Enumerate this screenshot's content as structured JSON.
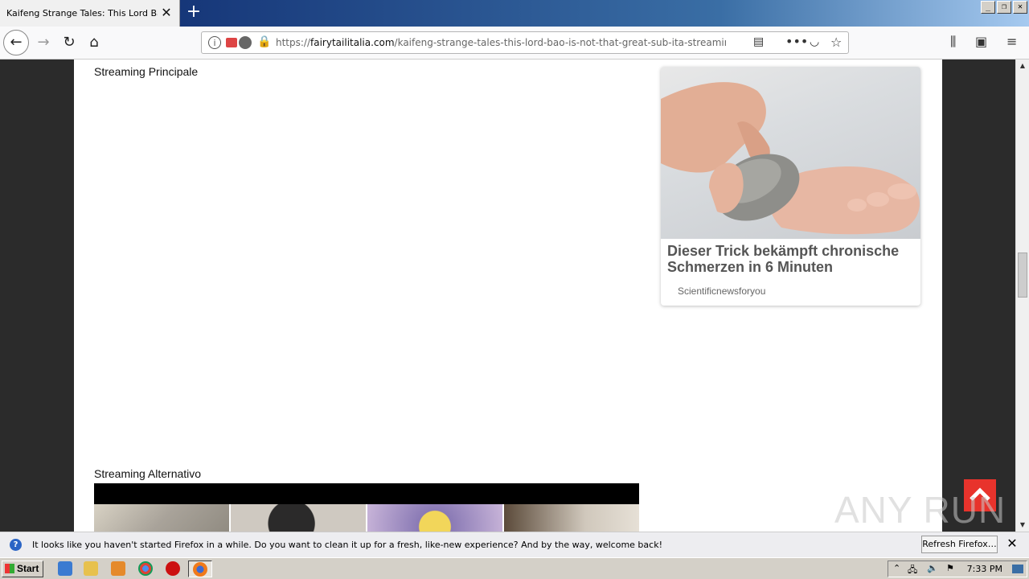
{
  "browser": {
    "tab_title": "Kaifeng Strange Tales: This Lord Bao is Not That Great Sub Ita Streaming",
    "url_prefix": "https://",
    "url_domain": "fairytailitalia.com",
    "url_path": "/kaifeng-strange-tales-this-lord-bao-is-not-that-great-sub-ita-streaming-",
    "tab_close": "✕",
    "new_tab": "+"
  },
  "window_controls": [
    "_",
    "❐",
    "✕"
  ],
  "page": {
    "streaming_main_label": "Streaming Principale",
    "streaming_alt_label": "Streaming Alternativo"
  },
  "ad": {
    "title": "Dieser Trick bekämpft chronische Schmerzen in 6 Minuten",
    "source": "Scientificnewsforyou"
  },
  "watermark": "ANY RUN",
  "notification": {
    "text": "It looks like you haven't started Firefox in a while. Do you want to clean it up for a fresh, like-new experience? And by the way, welcome back!",
    "button": "Refresh Firefox…",
    "close": "✕"
  },
  "taskbar": {
    "start_label": "Start",
    "clock": "7:33 PM"
  },
  "colors": {
    "accent_red": "#e8332c",
    "lock_green": "#12bc00"
  }
}
